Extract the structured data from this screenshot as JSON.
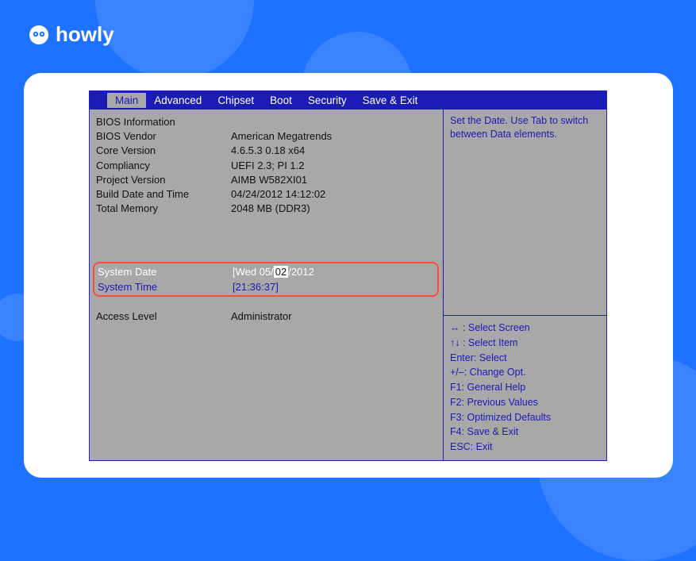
{
  "brand": {
    "name": "howly"
  },
  "tabs": [
    "Main",
    "Advanced",
    "Chipset",
    "Boot",
    "Security",
    "Save & Exit"
  ],
  "active_tab_index": 0,
  "info_section_title": "BIOS Information",
  "info_rows": [
    {
      "label": "BIOS Vendor",
      "value": "American Megatrends"
    },
    {
      "label": "Core Version",
      "value": "4.6.5.3 0.18 x64"
    },
    {
      "label": "Compliancy",
      "value": "UEFI 2.3; PI 1.2"
    },
    {
      "label": "Project Version",
      "value": "AIMB W582XI01"
    },
    {
      "label": "Build Date and Time",
      "value": "04/24/2012 14:12:02"
    },
    {
      "label": "Total Memory",
      "value": "2048 MB (DDR3)"
    }
  ],
  "system_date": {
    "label": "System Date",
    "prefix": "[Wed 05/",
    "selected": "02",
    "suffix": "/2012"
  },
  "system_time": {
    "label": "System Time",
    "value": "[21:36:37]"
  },
  "access": {
    "label": "Access Level",
    "value": "Administrator"
  },
  "help_top": "Set the Date. Use Tab to switch between Data elements.",
  "help_bottom": [
    "↔ : Select Screen",
    "↑↓ : Select Item",
    "Enter: Select",
    "+/–: Change Opt.",
    "F1: General Help",
    "F2: Previous Values",
    "F3: Optimized Defaults",
    "F4: Save & Exit",
    "ESC: Exit"
  ],
  "colors": {
    "page_bg": "#1f72ff",
    "navy": "#1b1bb5",
    "panel": "#a8a8a8",
    "highlight_border": "#ff4d3a"
  }
}
